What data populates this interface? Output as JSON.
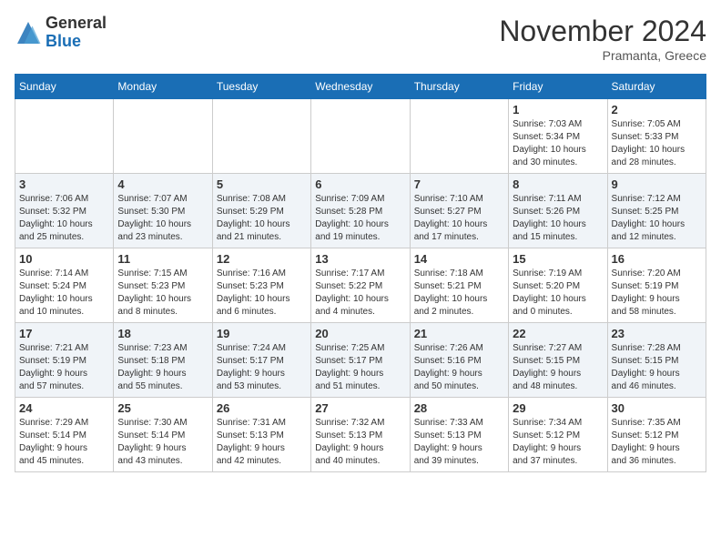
{
  "header": {
    "logo_general": "General",
    "logo_blue": "Blue",
    "month_title": "November 2024",
    "location": "Pramanta, Greece"
  },
  "weekdays": [
    "Sunday",
    "Monday",
    "Tuesday",
    "Wednesday",
    "Thursday",
    "Friday",
    "Saturday"
  ],
  "weeks": [
    [
      {
        "day": "",
        "info": ""
      },
      {
        "day": "",
        "info": ""
      },
      {
        "day": "",
        "info": ""
      },
      {
        "day": "",
        "info": ""
      },
      {
        "day": "",
        "info": ""
      },
      {
        "day": "1",
        "info": "Sunrise: 7:03 AM\nSunset: 5:34 PM\nDaylight: 10 hours\nand 30 minutes."
      },
      {
        "day": "2",
        "info": "Sunrise: 7:05 AM\nSunset: 5:33 PM\nDaylight: 10 hours\nand 28 minutes."
      }
    ],
    [
      {
        "day": "3",
        "info": "Sunrise: 7:06 AM\nSunset: 5:32 PM\nDaylight: 10 hours\nand 25 minutes."
      },
      {
        "day": "4",
        "info": "Sunrise: 7:07 AM\nSunset: 5:30 PM\nDaylight: 10 hours\nand 23 minutes."
      },
      {
        "day": "5",
        "info": "Sunrise: 7:08 AM\nSunset: 5:29 PM\nDaylight: 10 hours\nand 21 minutes."
      },
      {
        "day": "6",
        "info": "Sunrise: 7:09 AM\nSunset: 5:28 PM\nDaylight: 10 hours\nand 19 minutes."
      },
      {
        "day": "7",
        "info": "Sunrise: 7:10 AM\nSunset: 5:27 PM\nDaylight: 10 hours\nand 17 minutes."
      },
      {
        "day": "8",
        "info": "Sunrise: 7:11 AM\nSunset: 5:26 PM\nDaylight: 10 hours\nand 15 minutes."
      },
      {
        "day": "9",
        "info": "Sunrise: 7:12 AM\nSunset: 5:25 PM\nDaylight: 10 hours\nand 12 minutes."
      }
    ],
    [
      {
        "day": "10",
        "info": "Sunrise: 7:14 AM\nSunset: 5:24 PM\nDaylight: 10 hours\nand 10 minutes."
      },
      {
        "day": "11",
        "info": "Sunrise: 7:15 AM\nSunset: 5:23 PM\nDaylight: 10 hours\nand 8 minutes."
      },
      {
        "day": "12",
        "info": "Sunrise: 7:16 AM\nSunset: 5:23 PM\nDaylight: 10 hours\nand 6 minutes."
      },
      {
        "day": "13",
        "info": "Sunrise: 7:17 AM\nSunset: 5:22 PM\nDaylight: 10 hours\nand 4 minutes."
      },
      {
        "day": "14",
        "info": "Sunrise: 7:18 AM\nSunset: 5:21 PM\nDaylight: 10 hours\nand 2 minutes."
      },
      {
        "day": "15",
        "info": "Sunrise: 7:19 AM\nSunset: 5:20 PM\nDaylight: 10 hours\nand 0 minutes."
      },
      {
        "day": "16",
        "info": "Sunrise: 7:20 AM\nSunset: 5:19 PM\nDaylight: 9 hours\nand 58 minutes."
      }
    ],
    [
      {
        "day": "17",
        "info": "Sunrise: 7:21 AM\nSunset: 5:19 PM\nDaylight: 9 hours\nand 57 minutes."
      },
      {
        "day": "18",
        "info": "Sunrise: 7:23 AM\nSunset: 5:18 PM\nDaylight: 9 hours\nand 55 minutes."
      },
      {
        "day": "19",
        "info": "Sunrise: 7:24 AM\nSunset: 5:17 PM\nDaylight: 9 hours\nand 53 minutes."
      },
      {
        "day": "20",
        "info": "Sunrise: 7:25 AM\nSunset: 5:17 PM\nDaylight: 9 hours\nand 51 minutes."
      },
      {
        "day": "21",
        "info": "Sunrise: 7:26 AM\nSunset: 5:16 PM\nDaylight: 9 hours\nand 50 minutes."
      },
      {
        "day": "22",
        "info": "Sunrise: 7:27 AM\nSunset: 5:15 PM\nDaylight: 9 hours\nand 48 minutes."
      },
      {
        "day": "23",
        "info": "Sunrise: 7:28 AM\nSunset: 5:15 PM\nDaylight: 9 hours\nand 46 minutes."
      }
    ],
    [
      {
        "day": "24",
        "info": "Sunrise: 7:29 AM\nSunset: 5:14 PM\nDaylight: 9 hours\nand 45 minutes."
      },
      {
        "day": "25",
        "info": "Sunrise: 7:30 AM\nSunset: 5:14 PM\nDaylight: 9 hours\nand 43 minutes."
      },
      {
        "day": "26",
        "info": "Sunrise: 7:31 AM\nSunset: 5:13 PM\nDaylight: 9 hours\nand 42 minutes."
      },
      {
        "day": "27",
        "info": "Sunrise: 7:32 AM\nSunset: 5:13 PM\nDaylight: 9 hours\nand 40 minutes."
      },
      {
        "day": "28",
        "info": "Sunrise: 7:33 AM\nSunset: 5:13 PM\nDaylight: 9 hours\nand 39 minutes."
      },
      {
        "day": "29",
        "info": "Sunrise: 7:34 AM\nSunset: 5:12 PM\nDaylight: 9 hours\nand 37 minutes."
      },
      {
        "day": "30",
        "info": "Sunrise: 7:35 AM\nSunset: 5:12 PM\nDaylight: 9 hours\nand 36 minutes."
      }
    ]
  ]
}
